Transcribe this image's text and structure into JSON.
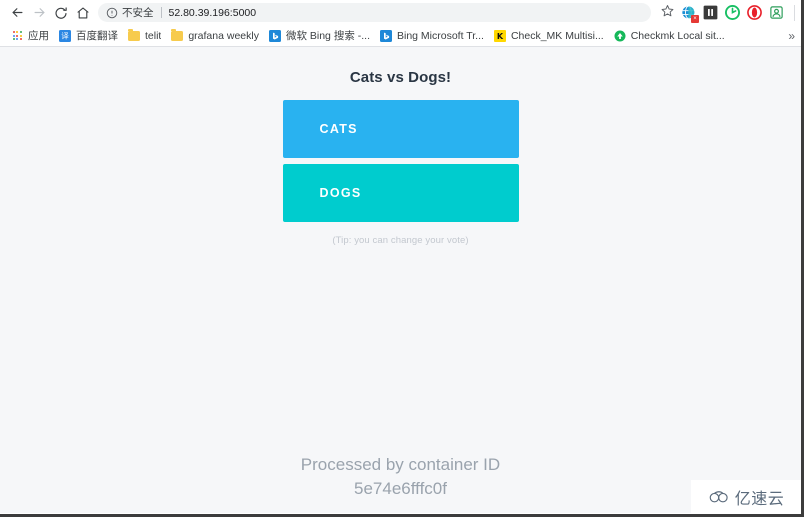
{
  "browser": {
    "nav": {
      "back_icon": "arrow-left-icon",
      "forward_icon": "arrow-right-icon",
      "reload_icon": "reload-icon",
      "home_icon": "home-icon"
    },
    "omnibox": {
      "info_icon": "info-circle-icon",
      "security_label": "不安全",
      "url": "52.80.39.196:5000",
      "star_icon": "star-icon"
    },
    "extensions": [
      {
        "name": "translate-extension-icon",
        "badge": "x"
      },
      {
        "name": "pause-extension-icon",
        "badge": ""
      },
      {
        "name": "green-circle-extension-icon",
        "badge": ""
      },
      {
        "name": "opera-red-extension-icon",
        "badge": ""
      },
      {
        "name": "profile-extension-icon",
        "badge": ""
      }
    ],
    "bookmarks": {
      "apps_label": "应用",
      "overflow_label": "»",
      "items": [
        {
          "icon": "baidu-translate-icon",
          "label": "百度翻译"
        },
        {
          "icon": "folder-icon",
          "label": "telit"
        },
        {
          "icon": "folder-icon",
          "label": "grafana weekly"
        },
        {
          "icon": "bing-icon",
          "label": "微软 Bing 搜索 -..."
        },
        {
          "icon": "bing-icon",
          "label": "Bing Microsoft Tr..."
        },
        {
          "icon": "checkmk-k-icon",
          "label": "Check_MK Multisi..."
        },
        {
          "icon": "checkmk-green-icon",
          "label": "Checkmk Local sit..."
        }
      ]
    }
  },
  "page": {
    "title": "Cats vs Dogs!",
    "buttons": [
      {
        "label": "CATS",
        "color": "#29b2f0",
        "name": "vote-cats-button"
      },
      {
        "label": "DOGS",
        "color": "#00ccce",
        "name": "vote-dogs-button"
      }
    ],
    "tip": "(Tip: you can change your vote)",
    "footer_line1": "Processed by container ID",
    "container_id": "5e74e6fffc0f"
  },
  "watermark": {
    "text": "亿速云",
    "icon": "cloud-icon"
  },
  "colors": {
    "cats": "#29b2f0",
    "dogs": "#00ccce",
    "page_bg": "#f6f7f9",
    "title": "#2a3644",
    "footer": "#9aa3ad"
  }
}
